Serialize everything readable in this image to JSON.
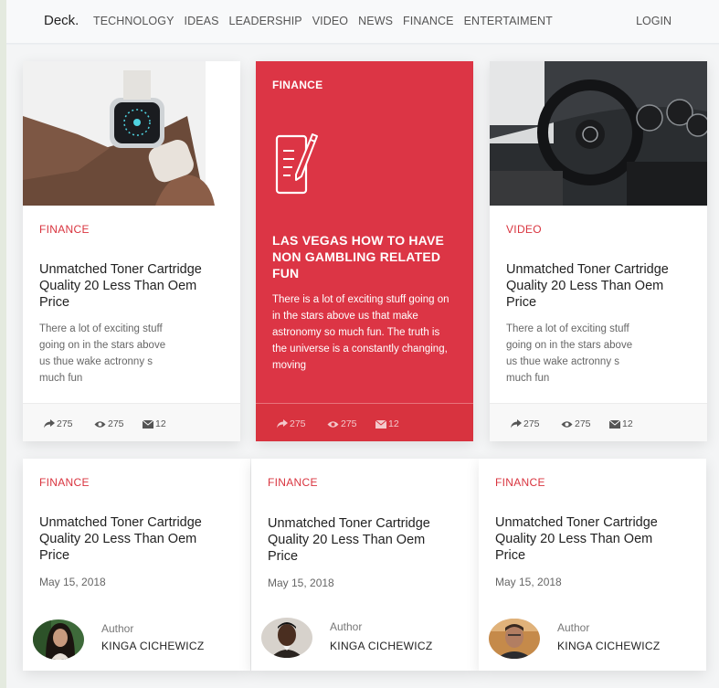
{
  "brand": "Deck.",
  "nav": {
    "links": [
      "TECHNOLOGY",
      "IDEAS",
      "LEADERSHIP",
      "VIDEO",
      "NEWS",
      "FINANCE",
      "ENTERTAIMENT"
    ],
    "login": "LOGIN"
  },
  "top_cards": [
    {
      "category": "FINANCE",
      "title": "Unmatched Toner Cartridge Quality 20 Less Than Oem Price",
      "excerpt": "There a lot of exciting stuff going on in the stars above us thue wake actronny s much fun",
      "shares": "275",
      "views": "275",
      "comments": "12",
      "image": "smartwatch-photo"
    },
    {
      "category": "FINANCE",
      "title": "LAS VEGAS HOW TO HAVE NON GAMBLING RELATED FUN",
      "excerpt": "There is a lot of exciting stuff going on in the stars above us that make astronomy so much fun. The truth is the universe is a constantly changing, moving",
      "shares": "275",
      "views": "275",
      "comments": "12",
      "image": "document-pen-icon"
    },
    {
      "category": "VIDEO",
      "title": "Unmatched Toner Cartridge Quality 20 Less Than Oem Price",
      "excerpt": "There a lot of exciting stuff going on in the stars above us thue wake actronny s much fun",
      "shares": "275",
      "views": "275",
      "comments": "12",
      "image": "car-interior-photo"
    }
  ],
  "bottom_cards": [
    {
      "category": "FINANCE",
      "title": "Unmatched Toner Cartridge Quality 20 Less Than Oem Price",
      "date": "May 15, 2018",
      "author_label": "Author",
      "author_name": "KINGA CICHEWICZ"
    },
    {
      "category": "FINANCE",
      "title": "Unmatched Toner Cartridge Quality 20 Less Than Oem Price",
      "date": "May 15, 2018",
      "author_label": "Author",
      "author_name": "KINGA CICHEWICZ"
    },
    {
      "category": "FINANCE",
      "title": "Unmatched Toner Cartridge Quality 20 Less Than Oem Price",
      "date": "May 15, 2018",
      "author_label": "Author",
      "author_name": "KINGA CICHEWICZ"
    }
  ],
  "colors": {
    "accent": "#dc3545",
    "text": "#222222",
    "muted": "#666666"
  }
}
